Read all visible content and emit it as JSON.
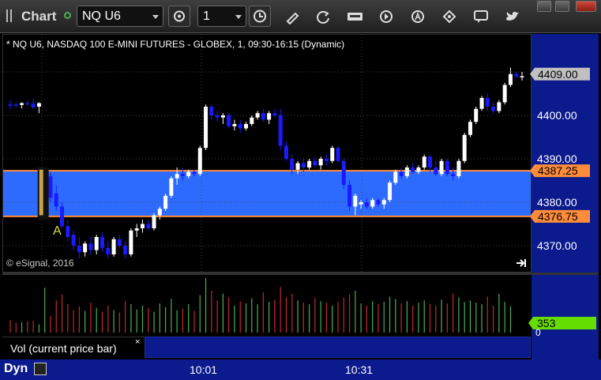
{
  "toolbar": {
    "title": "Chart",
    "symbol": "NQ U6",
    "interval": "1",
    "icons": [
      "grip-icon",
      "status-icon",
      "settings-gear-icon",
      "clock-icon",
      "pencil-icon",
      "refresh-icon",
      "get-icon",
      "play-icon",
      "alert-a-icon",
      "tools-icon",
      "chat-icon",
      "twitter-icon"
    ],
    "window_buttons": [
      "restore-icon",
      "maximize-icon",
      "close-icon"
    ]
  },
  "chart_info": "* NQ U6, NASDAQ 100 E-MINI FUTURES - GLOBEX, 1, 09:30-16:15 (Dynamic)",
  "copyright": "© eSignal, 2016",
  "price_axis": {
    "ticks": [
      "4410.00",
      "4400.00",
      "4390.00",
      "4380.00",
      "4370.00"
    ],
    "current_price": "4409.00",
    "band_top": "4387.25",
    "band_bottom": "4376.75"
  },
  "annotation": "A",
  "volume": {
    "label": "Vol (current price bar)",
    "close_glyph": "×",
    "current": "353",
    "zero_label": "0"
  },
  "time_axis": {
    "mode": "Dyn",
    "labels": [
      "10:01",
      "10:31"
    ]
  },
  "colors": {
    "band": "#2d6bff",
    "band_line": "#ff8c3a",
    "axis_bg": "#0b1a8c",
    "up_candle": "#ffffff",
    "down_candle": "#1a1aff",
    "vol_up": "#4caf50",
    "vol_down": "#c62828",
    "vol_current": "#66dd00"
  }
}
